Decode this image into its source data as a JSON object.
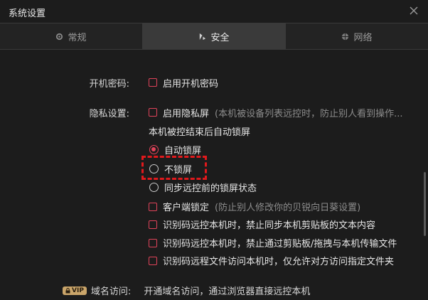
{
  "window": {
    "title": "系统设置"
  },
  "tabs": [
    {
      "label": "常规",
      "icon": "gear-icon"
    },
    {
      "label": "安全",
      "icon": "shield-icon",
      "active": true
    },
    {
      "label": "网络",
      "icon": "globe-icon"
    }
  ],
  "boot_password": {
    "label": "开机密码:",
    "option": "启用开机密码"
  },
  "privacy": {
    "label": "隐私设置:",
    "option": "启用隐私屏",
    "hint": "(本机被设备列表远控时，防止别人看到操作...",
    "after_control_label": "本机被控结束后自动锁屏",
    "radios": [
      "自动锁屏",
      "不锁屏",
      "同步远控前的锁屏状态"
    ],
    "selected_radio": "自动锁屏"
  },
  "client_lock": {
    "option": "客户端锁定",
    "hint": "(防止别人修改你的贝锐向日葵设置)"
  },
  "id_code_options": [
    "识别码远控本机时，禁止同步本机剪贴板的文本内容",
    "识别码远控本机时，禁止通过剪贴板/拖拽与本机传输文件",
    "识别码远程文件访问本机时，仅允许对方访问指定文件夹"
  ],
  "domain_access": {
    "badge": "VIP",
    "label": "域名访问:",
    "text": "开通域名访问，通过浏览器直接远控本机"
  },
  "colors": {
    "accent": "#e0435a",
    "highlight": "#e0191c",
    "background": "#1c1c1c",
    "active_tab": "#3a3a3a"
  }
}
